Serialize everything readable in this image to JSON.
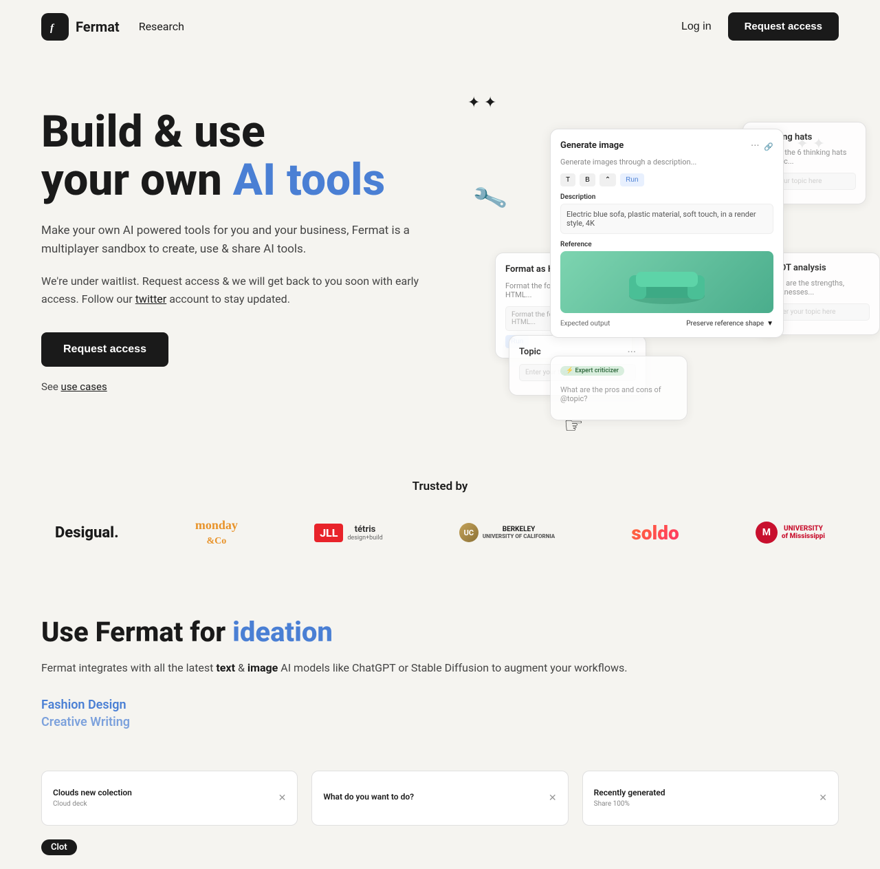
{
  "nav": {
    "logo_text": "Fermat",
    "logo_icon": "f",
    "research_label": "Research",
    "login_label": "Log in",
    "request_label": "Request access"
  },
  "hero": {
    "title_line1": "Build & use",
    "title_line2_plain": "your own ",
    "title_line2_highlight": "AI tools",
    "description": "Make your own AI powered tools for you and your business, Fermat is a multiplayer sandbox to create, use & share AI tools.",
    "waitlist_text1": "We're under waitlist. Request access & we will get back to you soon with early access. Follow our ",
    "waitlist_link": "twitter",
    "waitlist_text2": " account to stay updated.",
    "request_button": "Request access",
    "see_label": "See ",
    "use_cases_link": "use cases"
  },
  "mockup": {
    "main_card": {
      "title": "Generate image",
      "subtitle": "Generate images through a description...",
      "run_label": "Run",
      "desc_label": "Description",
      "desc_value": "Electric blue sofa, plastic material, soft touch, in a render style, 4K",
      "ref_label": "Reference",
      "output_label": "Expected output",
      "output_value": "Preserve reference shape"
    },
    "format_card": {
      "title": "Format as HTML",
      "subtitle": "Format the following text as HTML...",
      "run_label": "Run"
    },
    "topic_card": {
      "title": "Topic",
      "placeholder": "Enter your topic here"
    },
    "thinking_card": {
      "title": "6 thinking hats",
      "subtitle": "What are the 6 thinking hats for @topic..."
    },
    "swot_card": {
      "title": "SWOT analysis",
      "subtitle": "What are the strengths, weaknesses..."
    },
    "criticizer_card": {
      "title": "Expert criticizer",
      "subtitle": "What are the pros and cons of @topic?"
    }
  },
  "trusted": {
    "title": "Trusted by",
    "logos": [
      {
        "name": "Desigual.",
        "class": "desigual"
      },
      {
        "name": "monday &Co",
        "class": "monday"
      },
      {
        "name": "JLL + tétris",
        "class": "jll"
      },
      {
        "name": "UC Berkeley",
        "class": "berkeley"
      },
      {
        "name": "soldo",
        "class": "soldo"
      },
      {
        "name": "University of Mississippi",
        "class": "umiss"
      }
    ]
  },
  "use_section": {
    "title_plain": "Use Fermat for ",
    "title_highlight": "ideation",
    "description": "Fermat integrates with all the latest text & image AI models like ChatGPT or Stable Diffusion to augment your workflows.",
    "categories": [
      {
        "label": "Fashion Design"
      },
      {
        "label": "Creative Writing"
      }
    ],
    "screenshots": [
      {
        "title": "Clouds new colection",
        "sub": "Cloud deck",
        "badge": ""
      },
      {
        "title": "What do you want to do?",
        "sub": "",
        "badge": ""
      },
      {
        "title": "Recently generated",
        "sub": "Share 100%",
        "badge": ""
      }
    ]
  },
  "footer": {
    "clot_label": "Clot"
  },
  "icons": {
    "star": "✦",
    "cursor": "☞",
    "wrench": "🔧"
  }
}
